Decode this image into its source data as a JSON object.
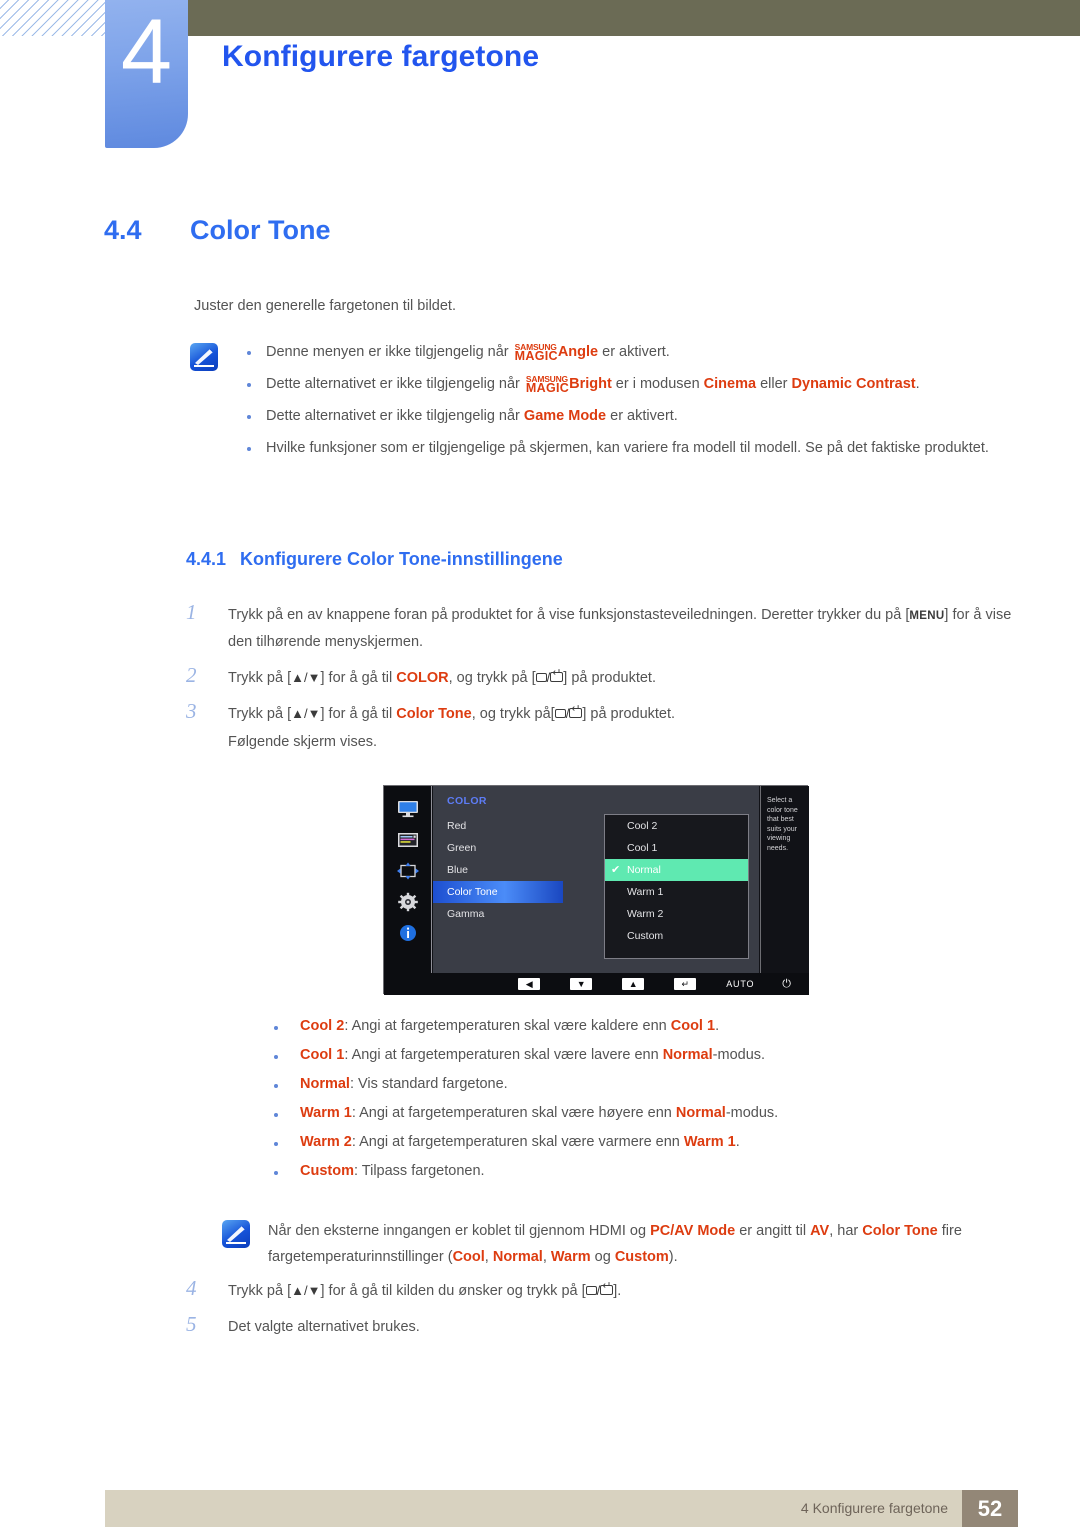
{
  "header": {
    "chapter_number": "4",
    "chapter_title": "Konfigurere fargetone"
  },
  "section": {
    "number": "4.4",
    "title": "Color Tone",
    "intro": "Juster den generelle fargetonen til bildet."
  },
  "note1": {
    "icon": "note-pen-icon",
    "bullets": [
      {
        "pre": "Denne menyen er ikke tilgjengelig når ",
        "logo_top": "SAMSUNG",
        "logo_bottom": "MAGIC",
        "logo_suffix": "Angle",
        "post": " er aktivert."
      },
      {
        "pre": "Dette alternativet er ikke tilgjengelig når ",
        "logo_top": "SAMSUNG",
        "logo_bottom": "MAGIC",
        "logo_suffix": "Bright",
        "mid": " er i modusen ",
        "em1": "Cinema",
        "mid2": " eller ",
        "em2": "Dynamic Contrast",
        "post": "."
      },
      {
        "pre": "Dette alternativet er ikke tilgjengelig når ",
        "em1": "Game Mode",
        "post": " er aktivert."
      },
      {
        "pre": "Hvilke funksjoner som er tilgjengelige på skjermen, kan variere fra modell til modell. Se på det faktiske produktet."
      }
    ]
  },
  "subsection": {
    "number": "4.4.1",
    "title": "Konfigurere Color Tone-innstillingene"
  },
  "steps": [
    {
      "num": "1",
      "part1": "Trykk på en av knappene foran på produktet for å vise funksjonstasteveiledningen. Deretter trykker du på [",
      "key": "MENU",
      "part2": "] for å vise den tilhørende menyskjermen."
    },
    {
      "num": "2",
      "part1": "Trykk på [",
      "arrows": "▲/▼",
      "part2": "] for å gå til ",
      "em": "COLOR",
      "part3": ", og trykk på [",
      "part4": "] på produktet."
    },
    {
      "num": "3",
      "part1": "Trykk på [",
      "arrows": "▲/▼",
      "part2": "] for å gå til ",
      "em": "Color Tone",
      "part3": ", og trykk på[",
      "part4": "] på produktet.",
      "extra": "Følgende skjerm vises."
    }
  ],
  "osd": {
    "menu_title": "COLOR",
    "rail_icons": [
      "monitor-icon",
      "picture-icon",
      "screen-adjust-icon",
      "setup-gear-icon",
      "information-icon"
    ],
    "items": [
      {
        "label": "Red",
        "selected": false
      },
      {
        "label": "Green",
        "selected": false
      },
      {
        "label": "Blue",
        "selected": false
      },
      {
        "label": "Color Tone",
        "selected": true
      },
      {
        "label": "Gamma",
        "selected": false
      }
    ],
    "submenu": [
      {
        "label": "Cool 2",
        "checked": false
      },
      {
        "label": "Cool 1",
        "checked": false
      },
      {
        "label": "Normal",
        "checked": true
      },
      {
        "label": "Warm 1",
        "checked": false
      },
      {
        "label": "Warm 2",
        "checked": false
      },
      {
        "label": "Custom",
        "checked": false
      }
    ],
    "help_text": "Select a color tone that best suits your viewing needs.",
    "buttons": {
      "left": "◀",
      "down": "▼",
      "up": "▲",
      "enter": "↵",
      "auto": "AUTO",
      "power": "⏻"
    },
    "colors": {
      "highlight_row": "#5fe9b1",
      "selected_item": "#4b8cf8",
      "menu_bg": "#3a3d46",
      "panel_bg": "#111217",
      "title": "#5d7cf5"
    }
  },
  "options": [
    {
      "term": "Cool 2",
      "pre": ": Angi at fargetemperaturen skal være kaldere enn ",
      "em": "Cool 1",
      "post": "."
    },
    {
      "term": "Cool 1",
      "pre": ": Angi at fargetemperaturen skal være lavere enn ",
      "em": "Normal",
      "post": "-modus."
    },
    {
      "term": "Normal",
      "pre": ": Vis standard fargetone.",
      "em": "",
      "post": ""
    },
    {
      "term": "Warm 1",
      "pre": ": Angi at fargetemperaturen skal være høyere enn ",
      "em": "Normal",
      "post": "-modus."
    },
    {
      "term": "Warm 2",
      "pre": ": Angi at fargetemperaturen skal være varmere enn ",
      "em": "Warm 1",
      "post": "."
    },
    {
      "term": "Custom",
      "pre": ": Tilpass fargetonen.",
      "em": "",
      "post": ""
    }
  ],
  "note2": {
    "icon": "note-pen-icon",
    "p1": "Når den eksterne inngangen er koblet til gjennom HDMI og ",
    "em1": "PC/AV Mode",
    "p2": " er angitt til ",
    "em2": "AV",
    "p3": ", har ",
    "em3": "Color Tone",
    "p4": " fire fargetemperaturinnstillinger (",
    "em4": "Cool",
    "p5": ", ",
    "em5": "Normal",
    "p6": ", ",
    "em6": "Warm",
    "p7": " og ",
    "em7": "Custom",
    "p8": ")."
  },
  "steps2": [
    {
      "num": "4",
      "part1": "Trykk på [",
      "arrows": "▲/▼",
      "part2": "] for å gå til kilden du ønsker og trykk på [",
      "part3": "]."
    },
    {
      "num": "5",
      "part1": "Det valgte alternativet brukes."
    }
  ],
  "footer": {
    "text": "4 Konfigurere fargetone",
    "page": "52"
  }
}
